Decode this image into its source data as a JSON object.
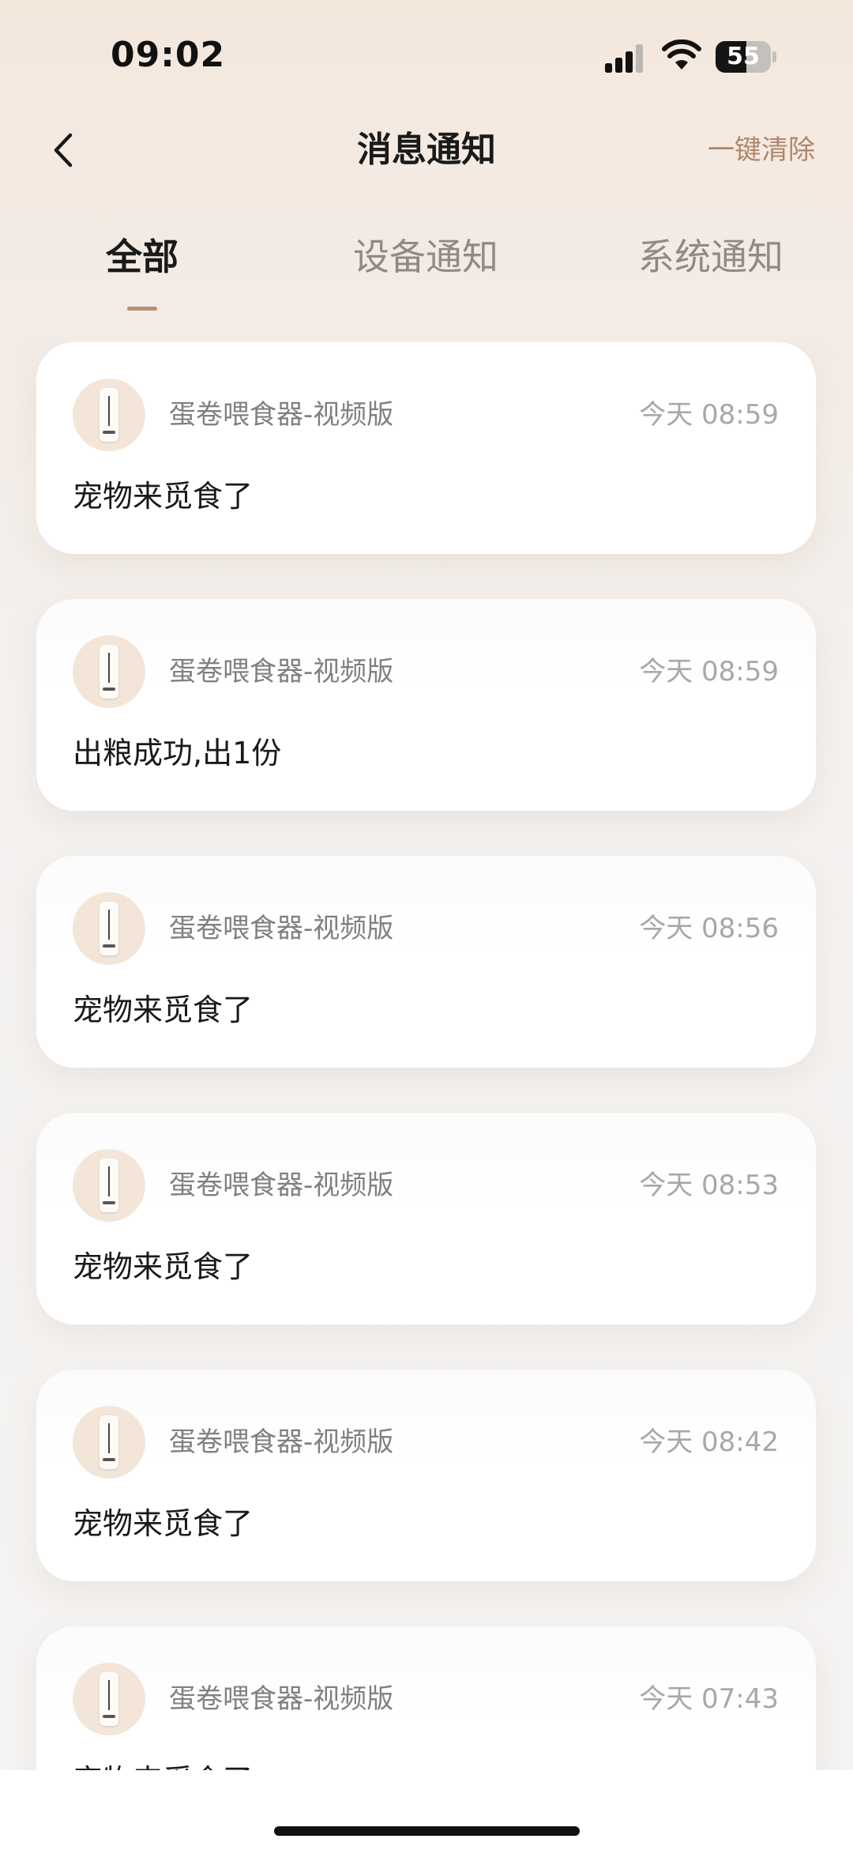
{
  "status_bar": {
    "time": "09:02",
    "battery_level": "55",
    "battery_fraction": 0.55
  },
  "header": {
    "title": "消息通知",
    "clear_all": "一键清除"
  },
  "tabs": [
    {
      "label": "全部",
      "active": true
    },
    {
      "label": "设备通知",
      "active": false
    },
    {
      "label": "系统通知",
      "active": false
    }
  ],
  "colors": {
    "accent": "#b0866a",
    "tab_indicator": "#b88f74",
    "avatar_bg": "#f3e6d8"
  },
  "messages": [
    {
      "device": "蛋卷喂食器-视频版",
      "time": "今天 08:59",
      "text": "宠物来觅食了"
    },
    {
      "device": "蛋卷喂食器-视频版",
      "time": "今天 08:59",
      "text": "出粮成功,出1份"
    },
    {
      "device": "蛋卷喂食器-视频版",
      "time": "今天 08:56",
      "text": "宠物来觅食了"
    },
    {
      "device": "蛋卷喂食器-视频版",
      "time": "今天 08:53",
      "text": "宠物来觅食了"
    },
    {
      "device": "蛋卷喂食器-视频版",
      "time": "今天 08:42",
      "text": "宠物来觅食了"
    },
    {
      "device": "蛋卷喂食器-视频版",
      "time": "今天 07:43",
      "text": "宠物来觅食了"
    }
  ]
}
